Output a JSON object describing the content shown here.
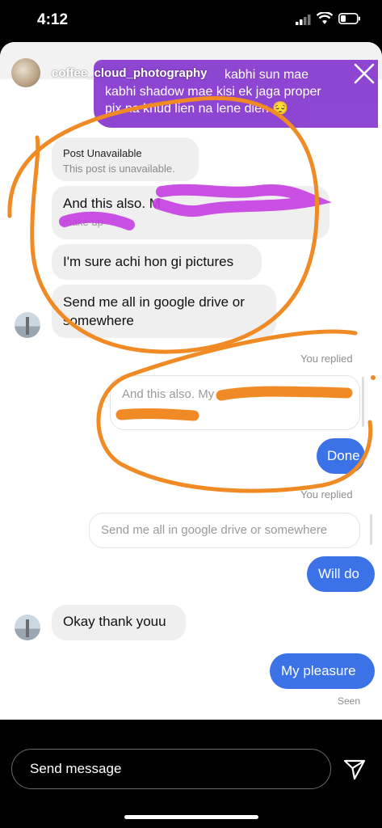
{
  "status_bar": {
    "time": "4:12"
  },
  "story": {
    "username": "coffee_cloud_photography",
    "reply_lines": [
      "kabhi sun mae",
      "kabhi shadow mae kisi ek jaga proper",
      "pix na khud lien na lene dien 😔"
    ]
  },
  "messages": {
    "post_unavailable_title": "Post Unavailable",
    "post_unavailable_sub": "This post is unavailable.",
    "and_this_also": "And this also. M",
    "and_this_also_tail": "make up",
    "sure_pictures": "I'm sure achi hon gi pictures",
    "send_drive": "Send me all in google drive or somewhere",
    "you_replied_1": "You replied",
    "quote_1": "And this also. My",
    "quote_1_tail": "make up",
    "done": "Done",
    "you_replied_2": "You replied",
    "quote_2": "Send me all in google drive or somewhere",
    "will_do": "Will do",
    "okay_thank": "Okay thank youu",
    "my_pleasure": "My pleasure",
    "seen": "Seen"
  },
  "composer": {
    "placeholder": "Send message"
  },
  "colors": {
    "sent_bubble": "#3b72e8",
    "received_bubble": "#efefef",
    "story_reply": "#8a3fd1",
    "annotation_orange": "#f08a24",
    "redaction_magenta": "#c43ee0"
  },
  "icons": [
    "signal-icon",
    "wifi-icon",
    "battery-icon",
    "close-icon",
    "send-icon"
  ]
}
